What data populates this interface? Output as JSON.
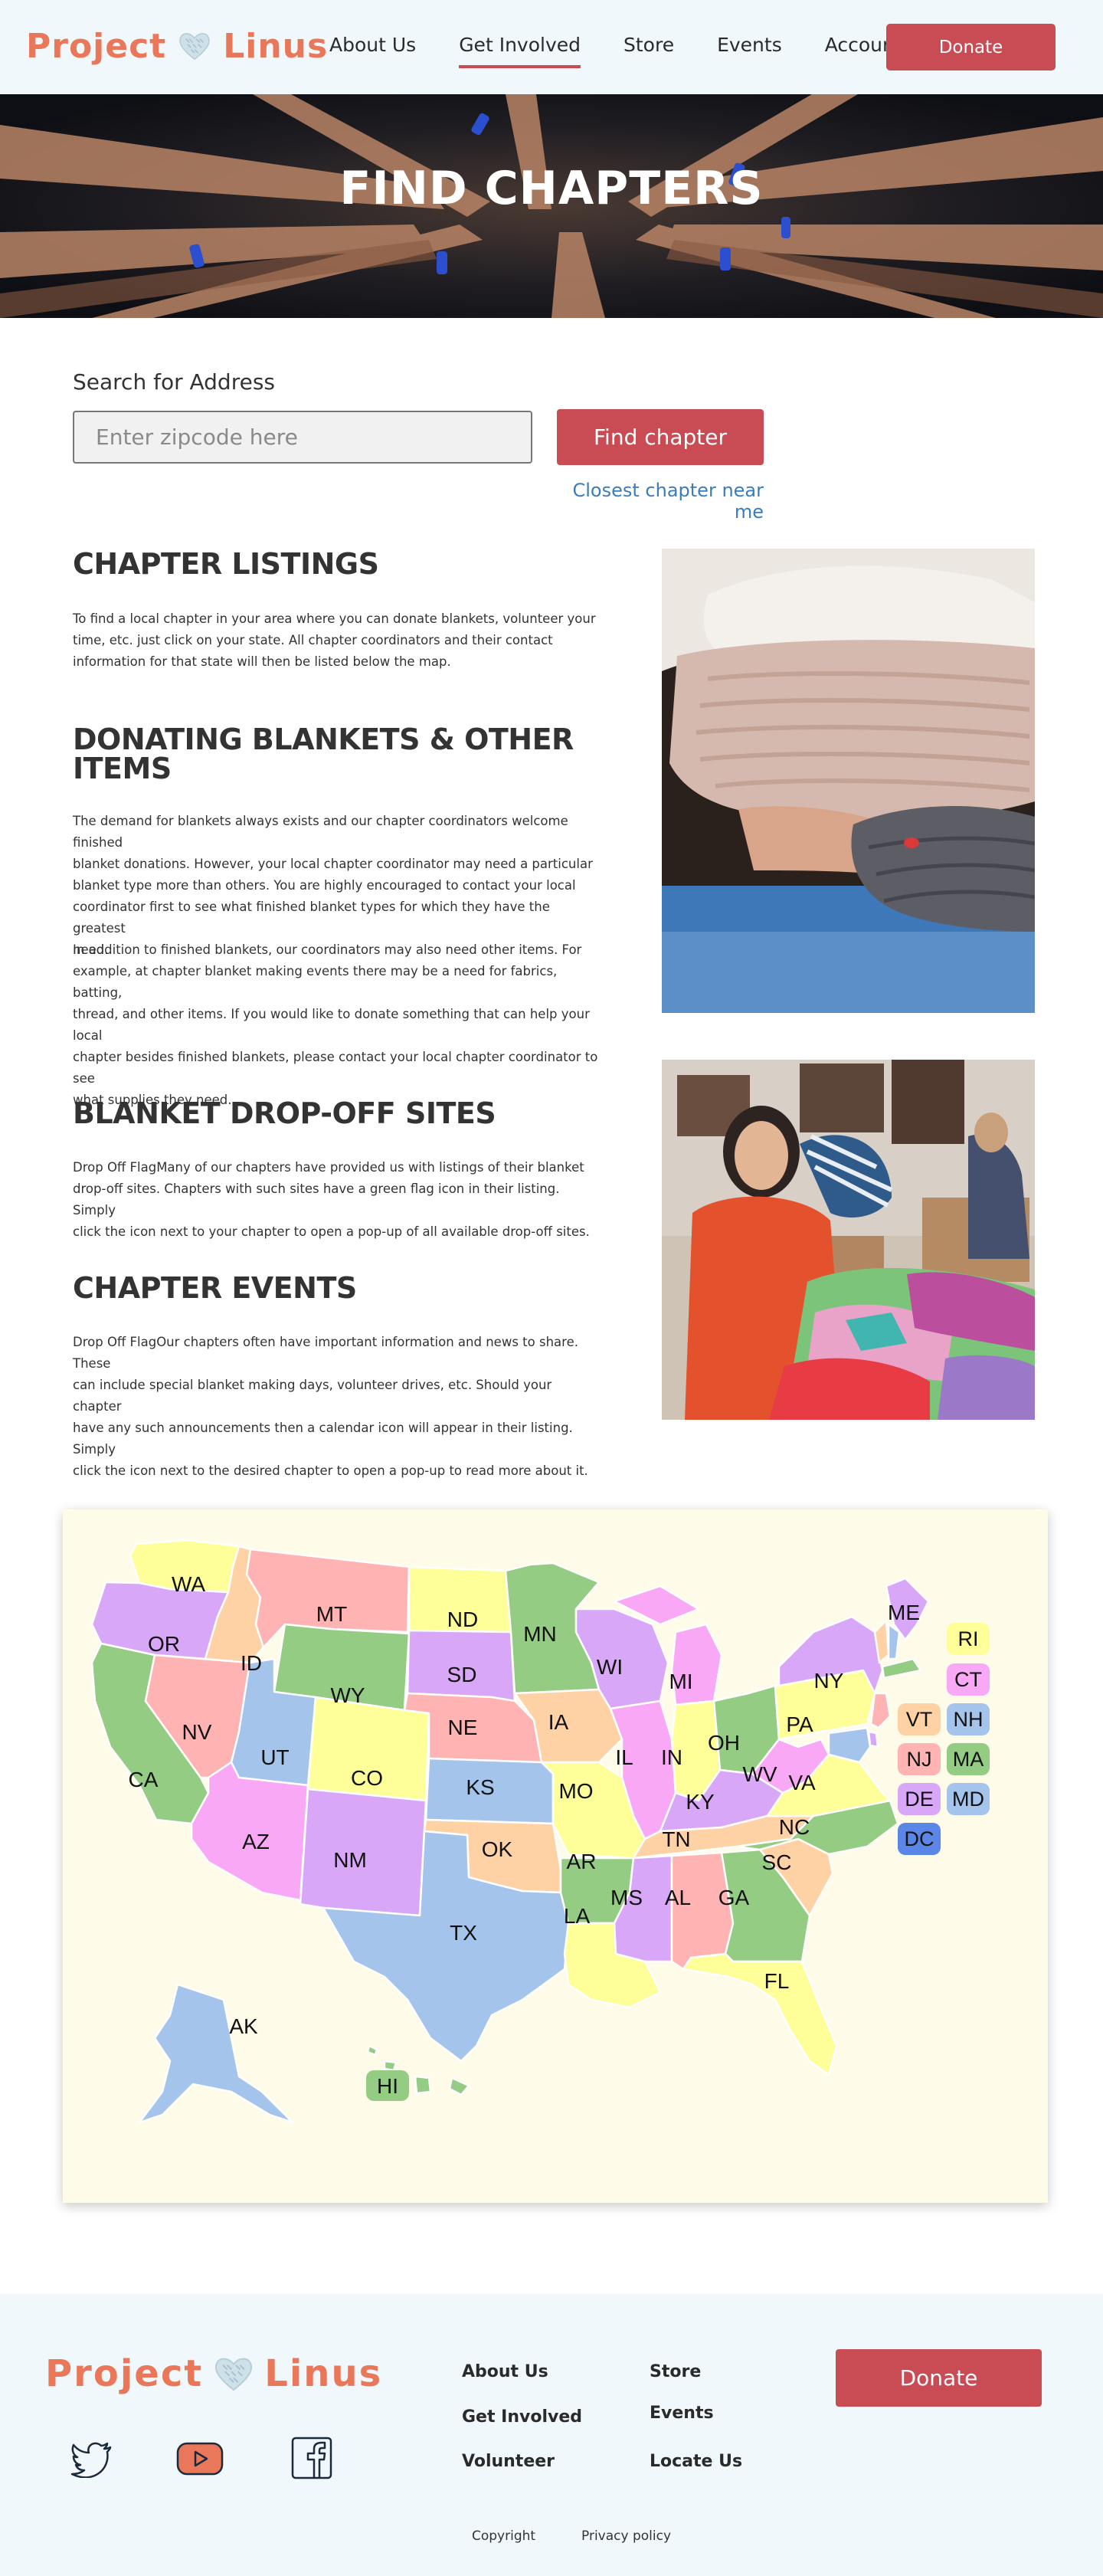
{
  "header": {
    "logo_left": "Project",
    "logo_right": "Linus",
    "nav": [
      "About Us",
      "Get Involved",
      "Store",
      "Events",
      "Account"
    ],
    "active_nav": "Get Involved",
    "donate_label": "Donate"
  },
  "hero": {
    "title": "FIND CHAPTERS"
  },
  "search": {
    "label": "Search for Address",
    "placeholder": "Enter zipcode here",
    "button_label": "Find chapter",
    "closest_link": "Closest chapter near me"
  },
  "sections": {
    "listings": {
      "heading": "CHAPTER LISTINGS",
      "lines": [
        "To find a local chapter in your area where you can donate blankets, volunteer your",
        "time, etc. just click on your state. All chapter coordinators and their contact",
        "information for that state will then be listed below the map."
      ]
    },
    "donating": {
      "heading_1": "DONATING BLANKETS & OTHER",
      "heading_2": "ITEMS",
      "p1_lines": [
        "The demand for blankets always exists and our chapter coordinators welcome finished",
        "blanket donations. However, your local chapter coordinator may need a particular",
        "blanket type more than others. You are highly encouraged to contact your local",
        "coordinator first to see what finished blanket types for which they have the greatest",
        "need."
      ],
      "p2_lines": [
        "In addition to finished blankets, our coordinators may also need other items. For",
        "example, at chapter blanket making events there may be a need for fabrics, batting,",
        "thread, and other items. If you would like to donate something that can help your local",
        "chapter besides finished blankets, please contact your local chapter coordinator to see",
        "what supplies they need."
      ]
    },
    "dropoff": {
      "heading": "BLANKET DROP-OFF SITES",
      "lines": [
        "Drop Off FlagMany of our chapters have provided us with listings of their blanket",
        "drop-off sites. Chapters with such sites have a green flag icon in their listing. Simply",
        "click the icon next to your chapter to open a pop-up of all available drop-off sites."
      ]
    },
    "events": {
      "heading": "CHAPTER EVENTS",
      "lines": [
        "Drop Off FlagOur chapters often have important information and news to share. These",
        "can include special blanket making days, volunteer drives, etc. Should your chapter",
        "have any such announcements then a calendar icon will appear in their listing. Simply",
        "click the icon next to the desired chapter to open a pop-up to read more about it."
      ]
    }
  },
  "map": {
    "states": [
      "WA",
      "OR",
      "CA",
      "ID",
      "NV",
      "MT",
      "WY",
      "UT",
      "AZ",
      "CO",
      "NM",
      "ND",
      "SD",
      "NE",
      "KS",
      "OK",
      "TX",
      "MN",
      "IA",
      "MO",
      "AR",
      "LA",
      "WI",
      "IL",
      "MI",
      "IN",
      "OH",
      "KY",
      "TN",
      "MS",
      "AL",
      "GA",
      "FL",
      "SC",
      "NC",
      "VA",
      "WV",
      "PA",
      "NY",
      "ME",
      "AK",
      "HI"
    ],
    "small_states": [
      "RI",
      "CT",
      "VT",
      "NH",
      "NJ",
      "MA",
      "DE",
      "MD",
      "DC"
    ],
    "colors": {
      "pink": "#ffb3b3",
      "yellow": "#ffff99",
      "purple": "#d9a7f7",
      "green": "#94cc84",
      "blue": "#a4c4ec",
      "peach": "#ffd2a6",
      "magenta": "#f9a8f5",
      "dc_blue": "#5a86e8"
    }
  },
  "footer": {
    "logo_left": "Project",
    "logo_right": "Linus",
    "links_col1": [
      "About Us",
      "Get Involved",
      "Volunteer"
    ],
    "links_col2": [
      "Store",
      "Events",
      "Locate Us"
    ],
    "donate_label": "Donate",
    "copyright": "Copyright",
    "privacy": "Privacy policy",
    "social": [
      "twitter-icon",
      "youtube-icon",
      "facebook-icon"
    ]
  }
}
